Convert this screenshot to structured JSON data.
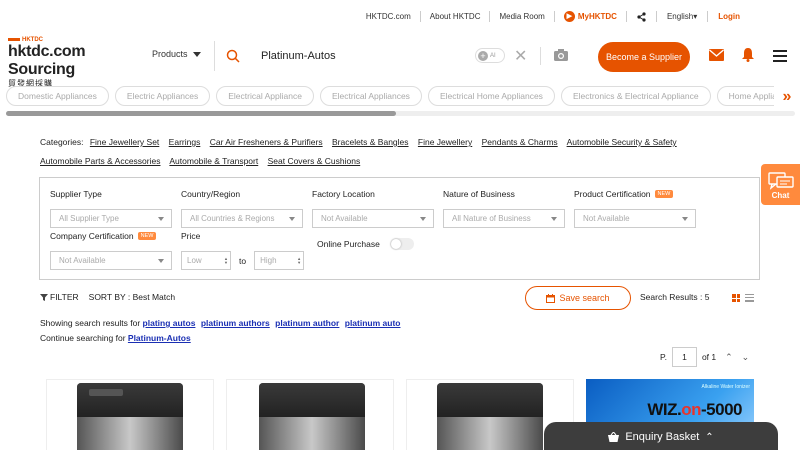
{
  "topbar": {
    "links": [
      "HKTDC.com",
      "About HKTDC",
      "Media Room"
    ],
    "my_label": "MyHKTDC",
    "language": "English",
    "login": "Login"
  },
  "header": {
    "logo_top": "HKTDC",
    "logo_main": "hktdc.com Sourcing",
    "logo_sub": "貿發網採購",
    "products_label": "Products",
    "search_value": "Platinum-Autos",
    "ai_label": "AI",
    "become_supplier": "Become a Supplier"
  },
  "chips": [
    "Domestic Appliances",
    "Electric Appliances",
    "Electrical Appliance",
    "Electrical Appliances",
    "Electrical Home Appliances",
    "Electronics & Electrical Appliance",
    "Home Applia"
  ],
  "categories": {
    "label": "Categories:",
    "items": [
      "Fine Jewellery Set",
      "Earrings",
      "Car Air Fresheners & Purifiers",
      "Bracelets & Bangles",
      "Fine Jewellery",
      "Pendants & Charms",
      "Automobile Security & Safety",
      "Automobile Parts & Accessories",
      "Automobile & Transport",
      "Seat Covers & Cushions"
    ]
  },
  "filters": {
    "supplier_type": {
      "label": "Supplier Type",
      "value": "All Supplier Type"
    },
    "country": {
      "label": "Country/Region",
      "value": "All Countries & Regions"
    },
    "factory": {
      "label": "Factory Location",
      "value": "Not Available"
    },
    "nature": {
      "label": "Nature of Business",
      "value": "All Nature of Business"
    },
    "product_cert": {
      "label": "Product Certification",
      "value": "Not Available",
      "badge": "NEW"
    },
    "company_cert": {
      "label": "Company Certification",
      "value": "Not Available",
      "badge": "NEW"
    },
    "price": {
      "label": "Price",
      "low": "Low",
      "high": "High",
      "to": "to"
    },
    "online_purchase": {
      "label": "Online Purchase",
      "enabled": false
    }
  },
  "sortbar": {
    "filter_label": "FILTER",
    "sort_label": "SORT BY :",
    "sort_value": "Best Match",
    "save_search": "Save search",
    "results": "Search Results : 5"
  },
  "showing": {
    "prefix": "Showing search results for",
    "terms": [
      "plating autos",
      "platinum authors",
      "platinum author",
      "platinum auto"
    ],
    "continue_prefix": "Continue searching for",
    "continue_term": "Platinum-Autos"
  },
  "pager": {
    "label": "P.",
    "current": "1",
    "of": "of 1"
  },
  "ad": {
    "small_text": "Alkaline Water Ionizer",
    "brand_main": "WIZ.",
    "brand_on": "on",
    "brand_num": "-5000"
  },
  "chat_label": "Chat",
  "basket_label": "Enquiry Basket",
  "colors": {
    "accent": "#e65300",
    "link": "#1a2fb3",
    "basket": "#3d3d3d"
  }
}
